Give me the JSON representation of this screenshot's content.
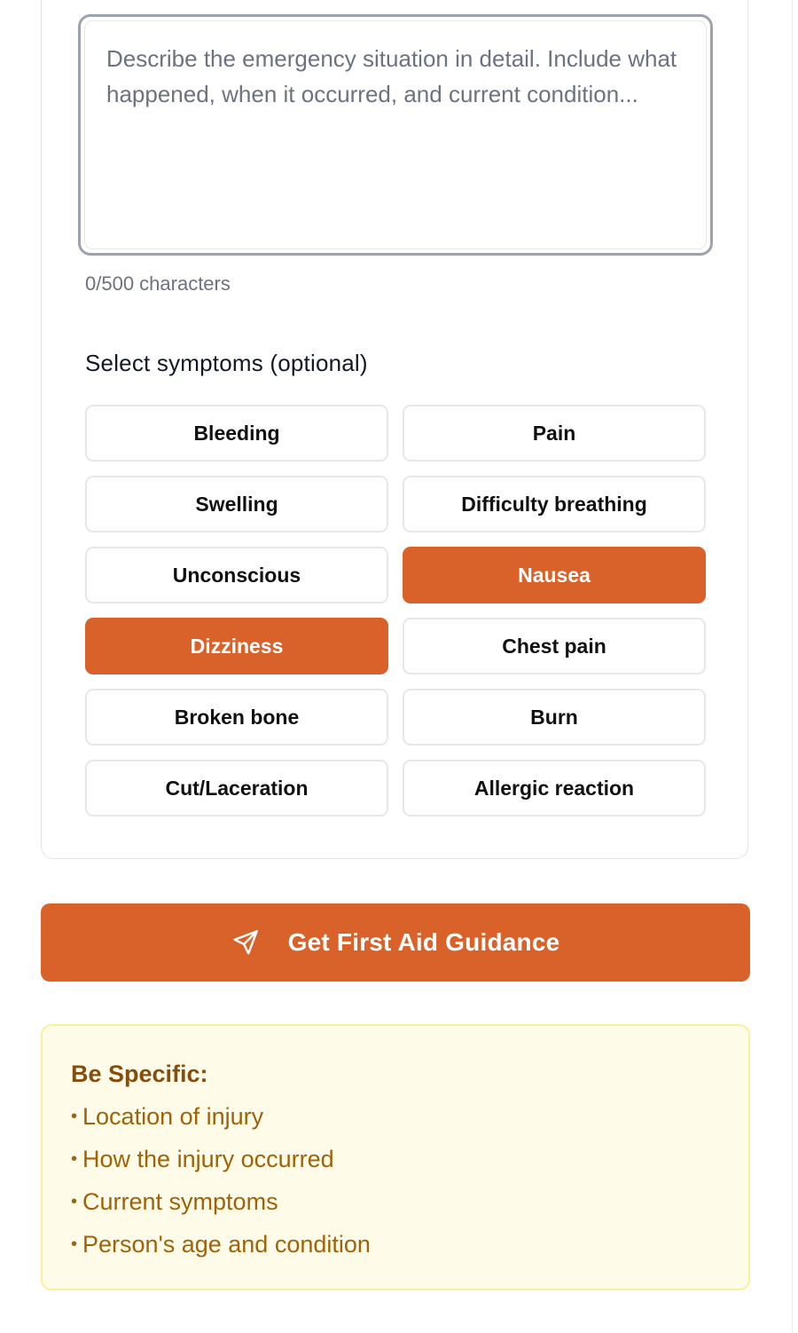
{
  "description": {
    "placeholder": "Describe the emergency situation in detail. Include what happened, when it occurred, and current condition...",
    "value": "",
    "char_count_label": "0/500 characters"
  },
  "symptoms": {
    "title": "Select symptoms (optional)",
    "options": [
      {
        "label": "Bleeding",
        "selected": false
      },
      {
        "label": "Pain",
        "selected": false
      },
      {
        "label": "Swelling",
        "selected": false
      },
      {
        "label": "Difficulty breathing",
        "selected": false
      },
      {
        "label": "Unconscious",
        "selected": false
      },
      {
        "label": "Nausea",
        "selected": true
      },
      {
        "label": "Dizziness",
        "selected": true
      },
      {
        "label": "Chest pain",
        "selected": false
      },
      {
        "label": "Broken bone",
        "selected": false
      },
      {
        "label": "Burn",
        "selected": false
      },
      {
        "label": "Cut/Laceration",
        "selected": false
      },
      {
        "label": "Allergic reaction",
        "selected": false
      }
    ]
  },
  "submit": {
    "label": "Get First Aid Guidance",
    "icon": "send-icon"
  },
  "tips": {
    "title": "Be Specific:",
    "items": [
      "Location of injury",
      "How the injury occurred",
      "Current symptoms",
      "Person's age and condition"
    ]
  },
  "colors": {
    "accent": "#d9622b",
    "tips_background": "#fefce8",
    "tips_border": "#fbef9b",
    "tips_title": "#854d0e",
    "tips_text": "#a16207"
  }
}
